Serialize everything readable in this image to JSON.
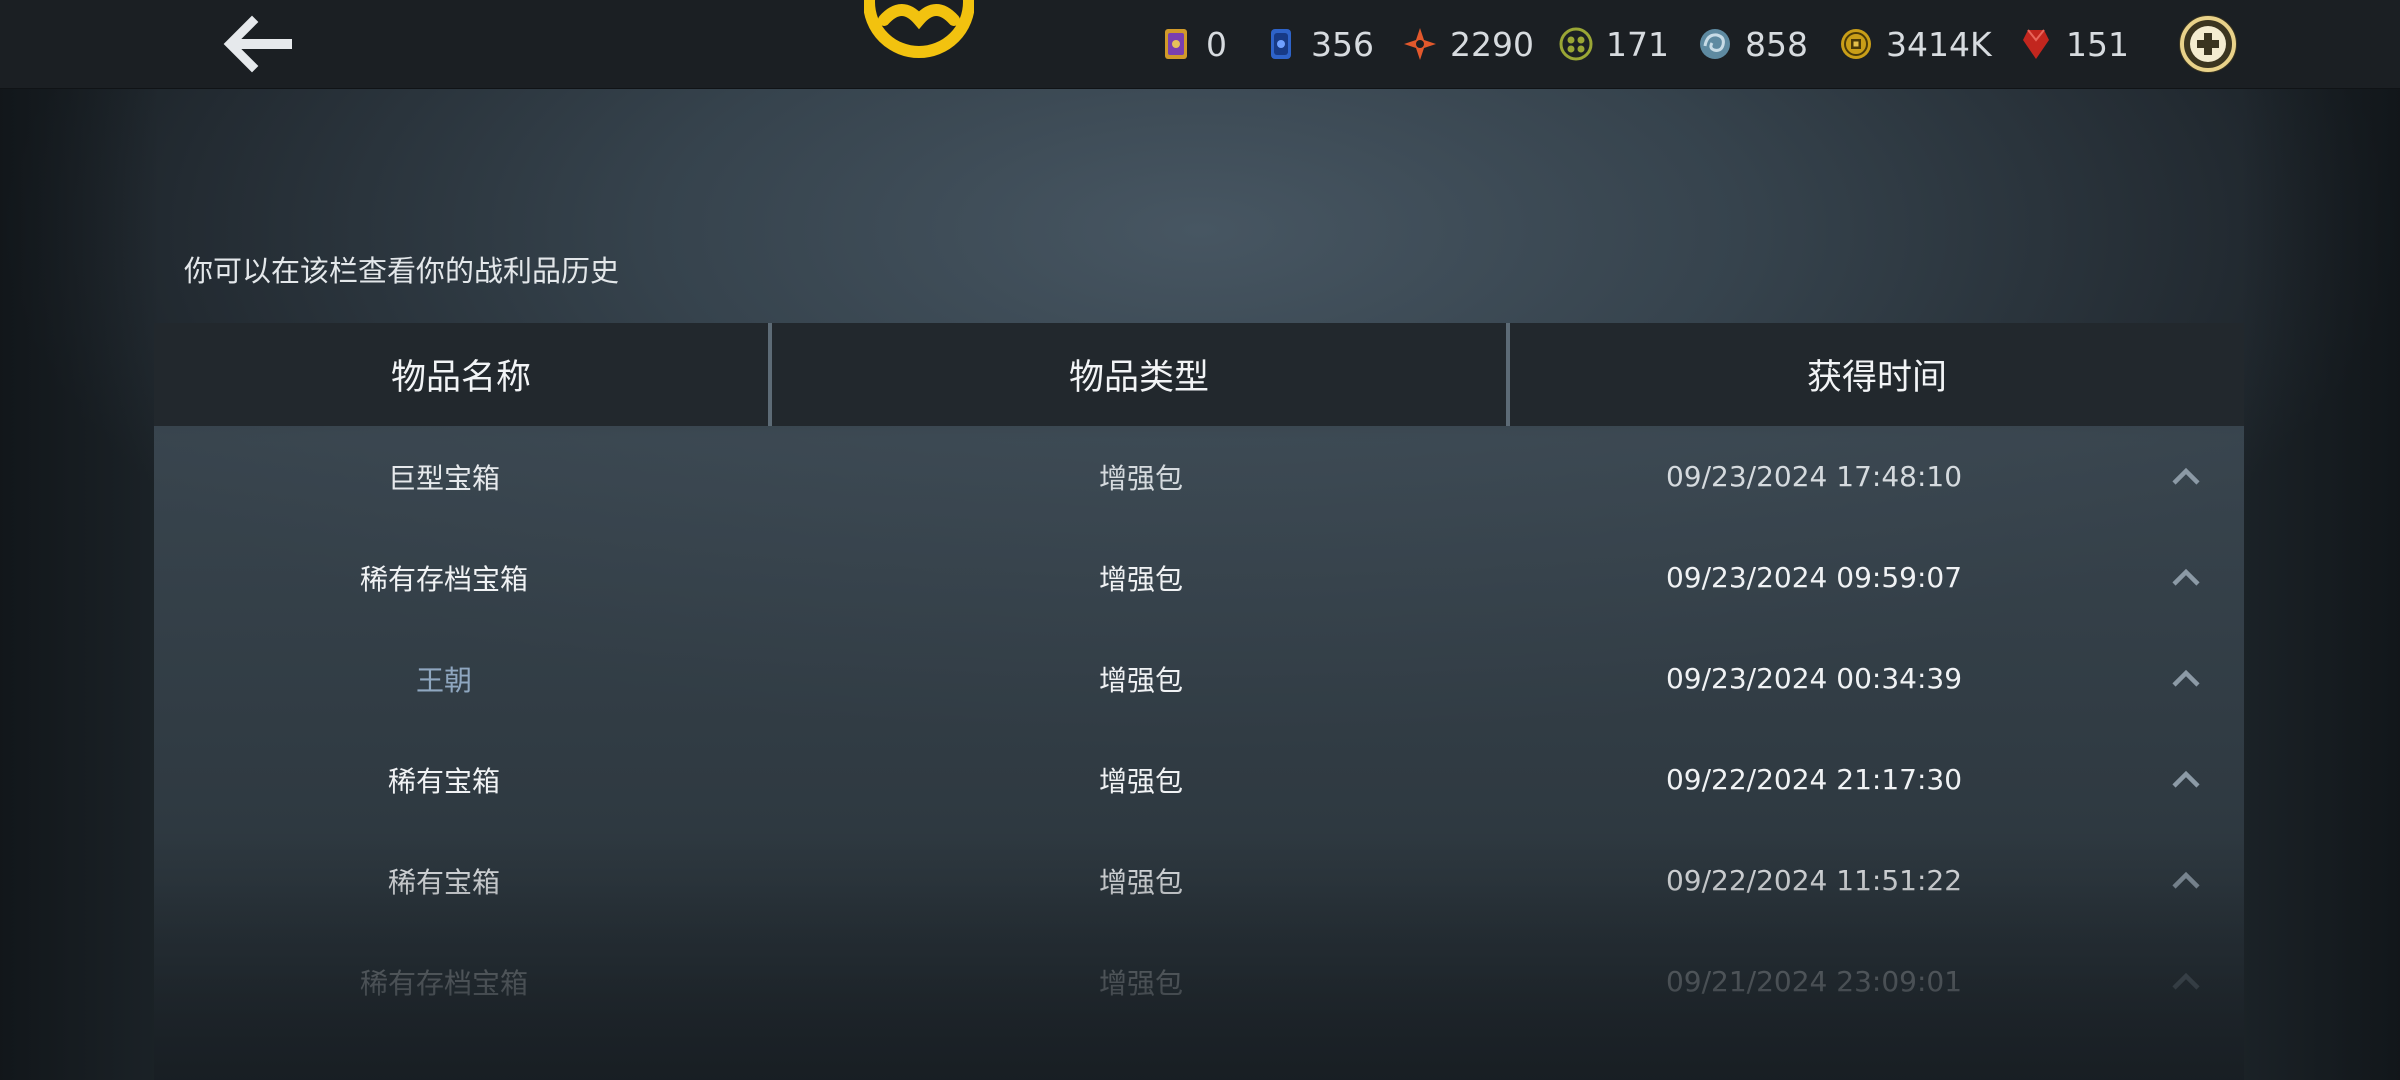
{
  "colors": {
    "accent_gold": "#f2c20f",
    "text_primary": "#f0f2f4",
    "text_muted_blue": "#8fa7c0"
  },
  "topbar": {
    "back_icon": "back-arrow-icon",
    "emblem_icon": "gold-emblem-icon",
    "currencies": [
      {
        "icon": "ticket-card-icon",
        "value": "0"
      },
      {
        "icon": "blue-card-icon",
        "value": "356"
      },
      {
        "icon": "orange-star-shard-icon",
        "value": "2290"
      },
      {
        "icon": "green-orb-icon",
        "value": "171"
      },
      {
        "icon": "blue-swirl-icon",
        "value": "858"
      },
      {
        "icon": "gold-coin-icon",
        "value": "3414K"
      },
      {
        "icon": "red-gem-icon",
        "value": "151"
      }
    ],
    "plus_icon": "plus-circle-icon"
  },
  "page": {
    "hint": "你可以在该栏查看你的战利品历史"
  },
  "table": {
    "columns": [
      "物品名称",
      "物品类型",
      "获得时间"
    ],
    "rows": [
      {
        "name": "巨型宝箱",
        "type": "增强包",
        "time": "09/23/2024 17:48:10"
      },
      {
        "name": "稀有存档宝箱",
        "type": "增强包",
        "time": "09/23/2024 09:59:07"
      },
      {
        "name": "王朝",
        "type": "增强包",
        "time": "09/23/2024 00:34:39"
      },
      {
        "name": "稀有宝箱",
        "type": "增强包",
        "time": "09/22/2024 21:17:30"
      },
      {
        "name": "稀有宝箱",
        "type": "增强包",
        "time": "09/22/2024 11:51:22"
      },
      {
        "name": "稀有存档宝箱",
        "type": "增强包",
        "time": "09/21/2024 23:09:01"
      }
    ]
  }
}
